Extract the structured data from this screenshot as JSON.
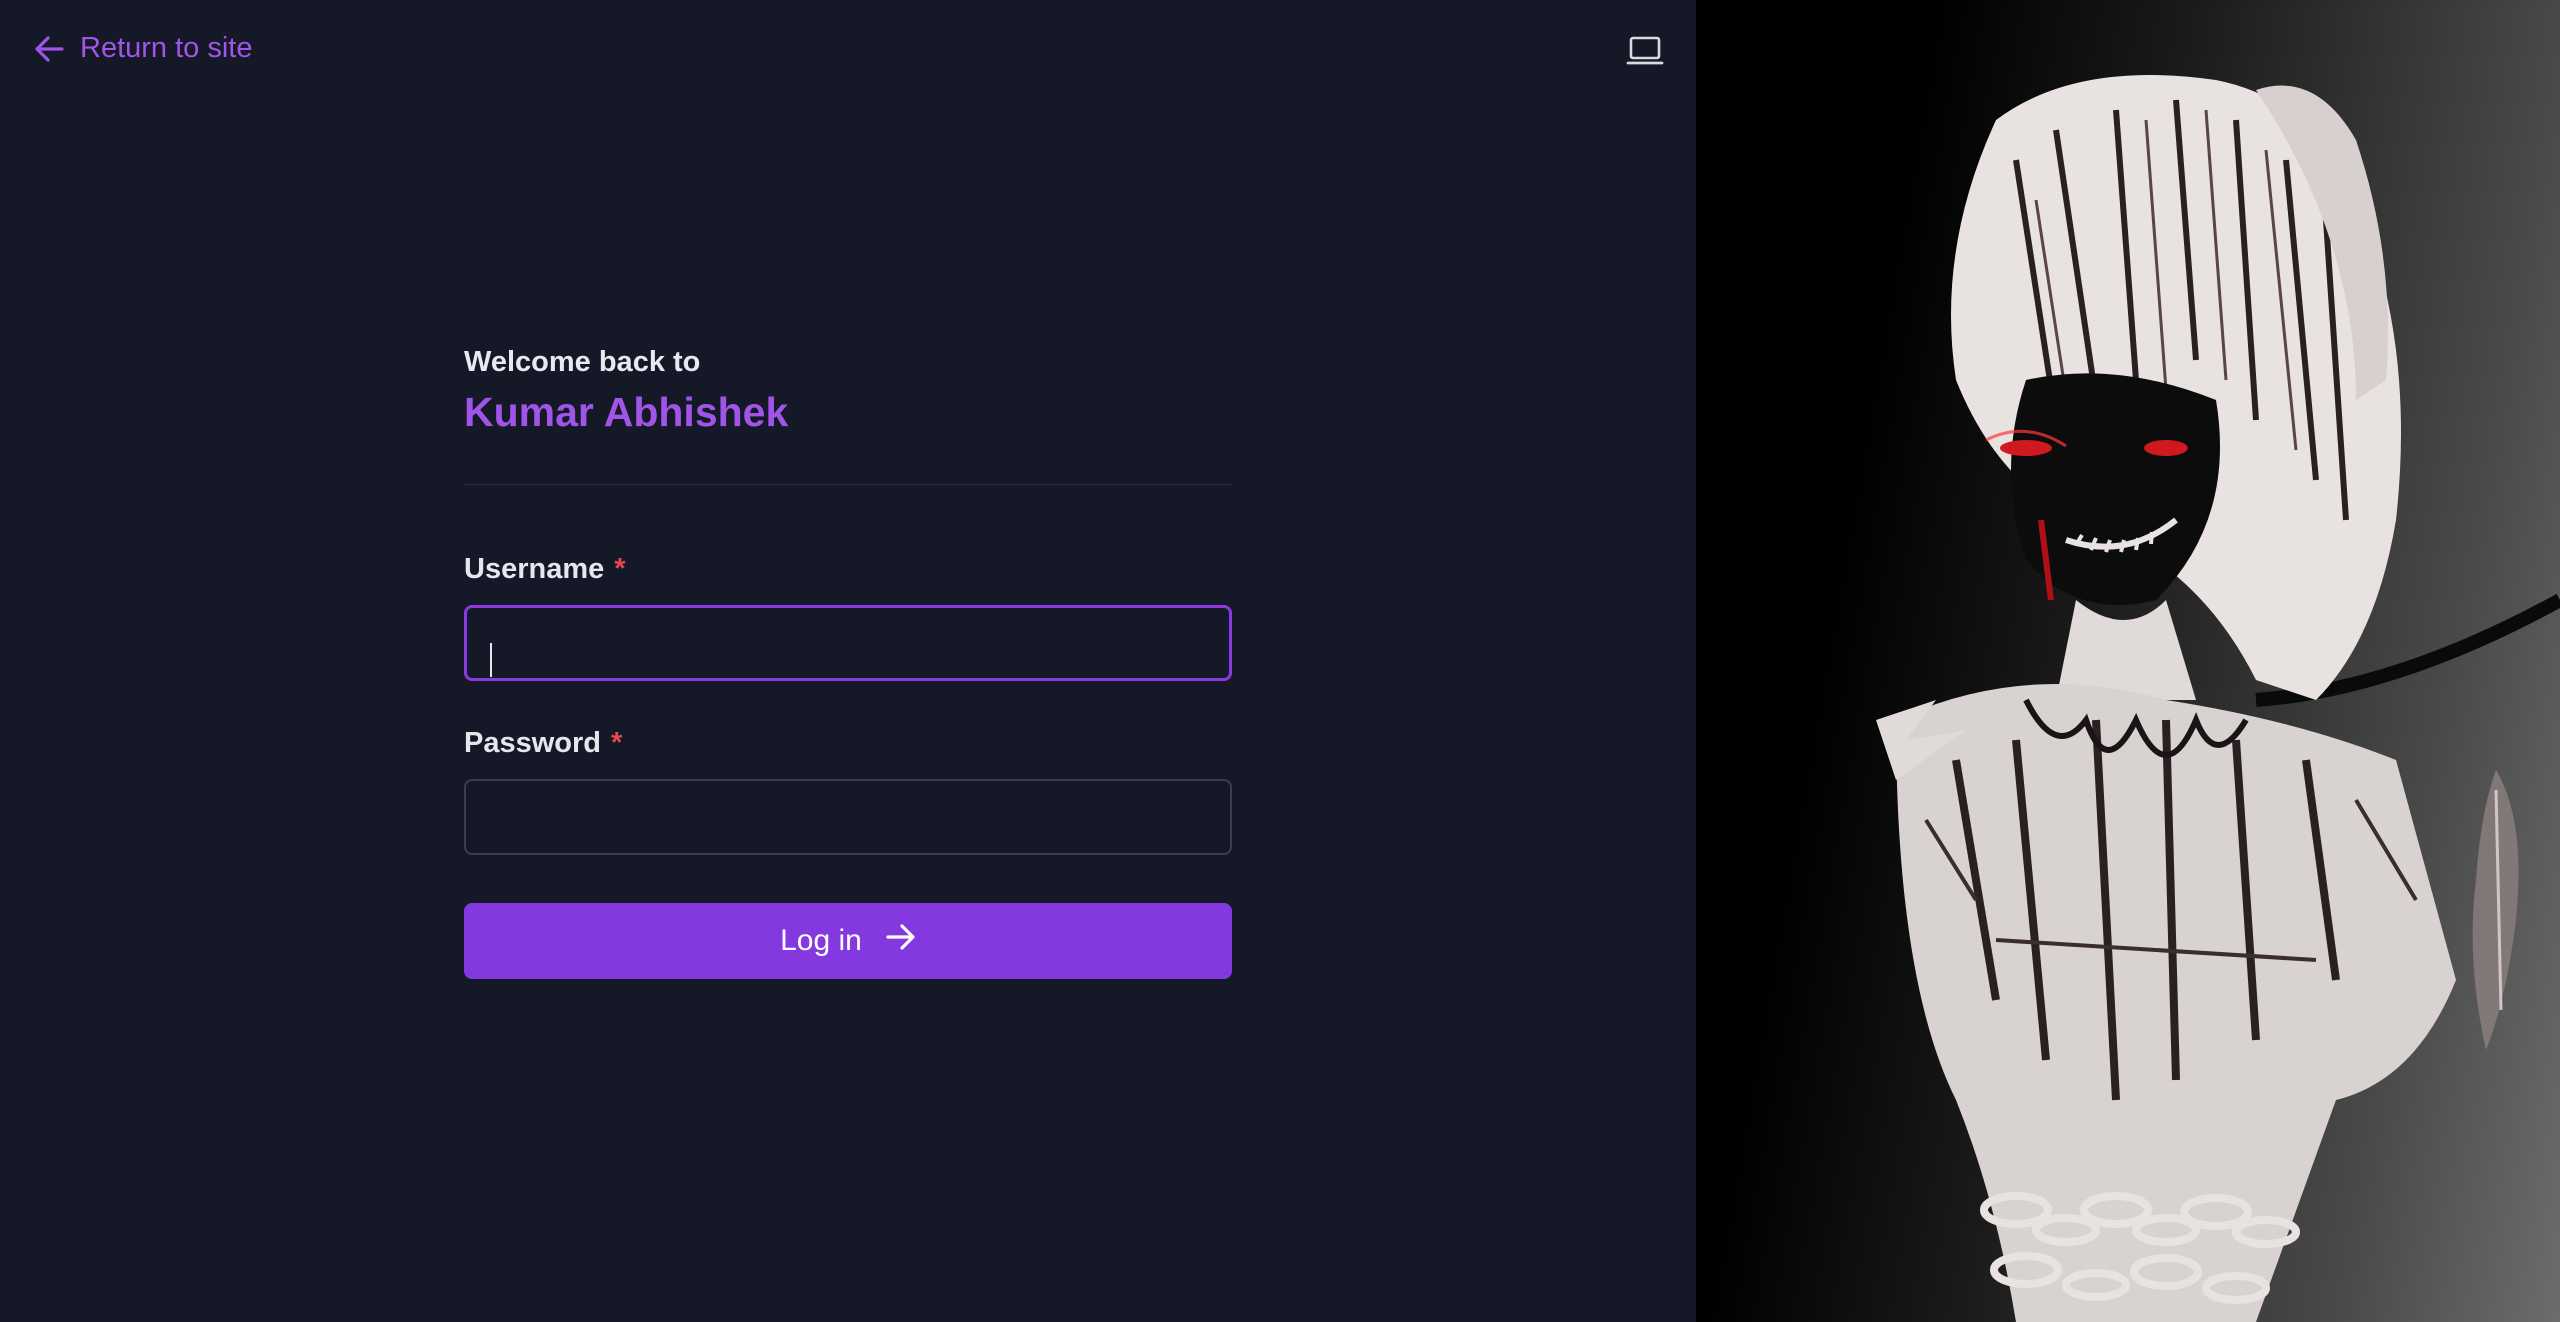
{
  "nav": {
    "return_label": "Return to site",
    "return_icon": "arrow-left-icon",
    "theme_icon": "laptop-icon"
  },
  "header": {
    "welcome_text": "Welcome back to",
    "site_name": "Kumar Abhishek"
  },
  "form": {
    "username": {
      "label": "Username",
      "required_mark": "*",
      "value": "",
      "focused": true
    },
    "password": {
      "label": "Password",
      "required_mark": "*",
      "value": ""
    },
    "submit_label": "Log in",
    "submit_icon": "arrow-right-icon"
  },
  "side_image": {
    "description_icon": "anime-character-artwork"
  },
  "colors": {
    "background": "#141827",
    "accent": "#8338e0",
    "accent_text": "#a055e8",
    "required": "#e5484d"
  }
}
